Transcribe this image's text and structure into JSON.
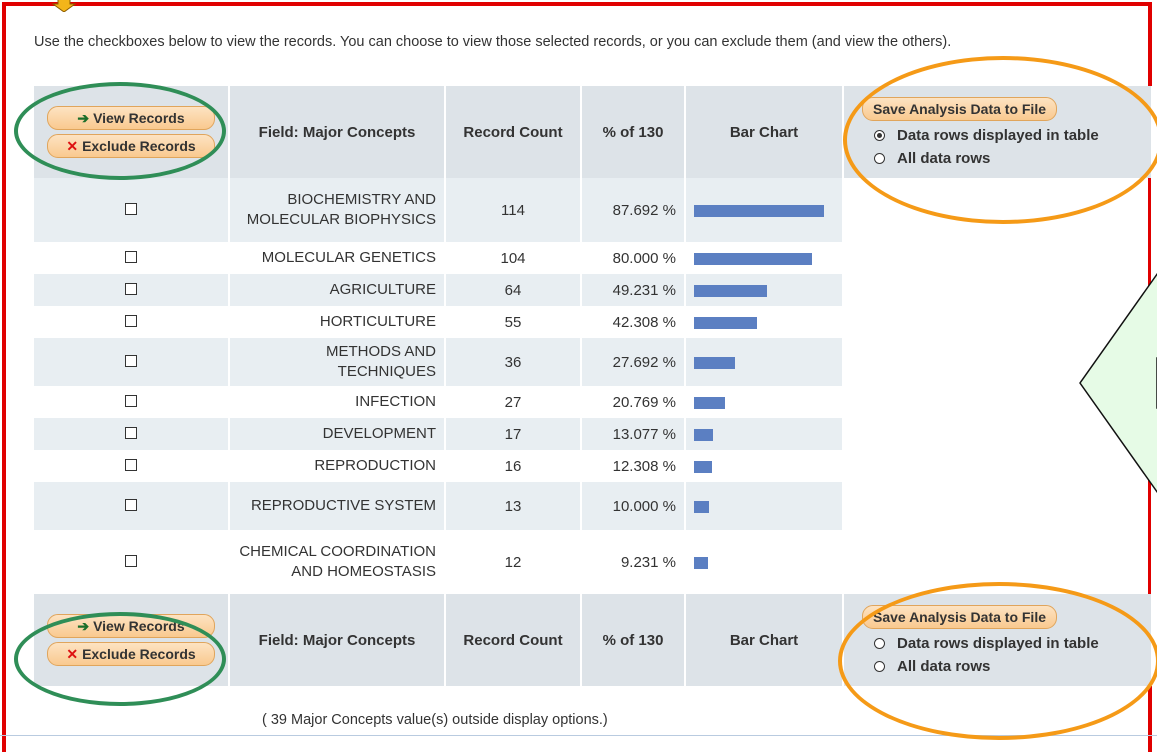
{
  "instructions": "Use the checkboxes below to view the records. You can choose to view those selected records, or you can exclude them (and view the others).",
  "buttons": {
    "view_records": "View Records",
    "exclude_records": "Exclude Records",
    "save_analysis": "Save Analysis Data to File"
  },
  "headers": {
    "field": "Field: Major Concepts",
    "record_count": "Record Count",
    "percent": "% of 130",
    "bar_chart": "Bar Chart"
  },
  "radio_options": {
    "displayed": "Data rows displayed in table",
    "all": "All data rows"
  },
  "rows": [
    {
      "field": "BIOCHEMISTRY AND MOLECULAR BIOPHYSICS",
      "count": "114",
      "percent": "87.692 %",
      "bar_fraction": 0.877
    },
    {
      "field": "MOLECULAR GENETICS",
      "count": "104",
      "percent": "80.000 %",
      "bar_fraction": 0.8
    },
    {
      "field": "AGRICULTURE",
      "count": "64",
      "percent": "49.231 %",
      "bar_fraction": 0.492
    },
    {
      "field": "HORTICULTURE",
      "count": "55",
      "percent": "42.308 %",
      "bar_fraction": 0.423
    },
    {
      "field": "METHODS AND TECHNIQUES",
      "count": "36",
      "percent": "27.692 %",
      "bar_fraction": 0.277
    },
    {
      "field": "INFECTION",
      "count": "27",
      "percent": "20.769 %",
      "bar_fraction": 0.208
    },
    {
      "field": "DEVELOPMENT",
      "count": "17",
      "percent": "13.077 %",
      "bar_fraction": 0.131
    },
    {
      "field": "REPRODUCTION",
      "count": "16",
      "percent": "12.308 %",
      "bar_fraction": 0.123
    },
    {
      "field": "REPRODUCTIVE SYSTEM",
      "count": "13",
      "percent": "10.000 %",
      "bar_fraction": 0.1
    },
    {
      "field": "CHEMICAL COORDINATION AND HOMEOSTASIS",
      "count": "12",
      "percent": "9.231 %",
      "bar_fraction": 0.092
    }
  ],
  "footnote": "( 39 Major Concepts value(s) outside display options.)",
  "colors": {
    "frame": "#e00000",
    "bar": "#5b7fc2",
    "green_highlight": "#2f8e57",
    "orange_highlight": "#f59a17",
    "header_bg": "#dde3e8"
  },
  "icons": {
    "view": "arrow-right-icon",
    "exclude": "x-icon",
    "pointer": "down-arrow-icon"
  }
}
